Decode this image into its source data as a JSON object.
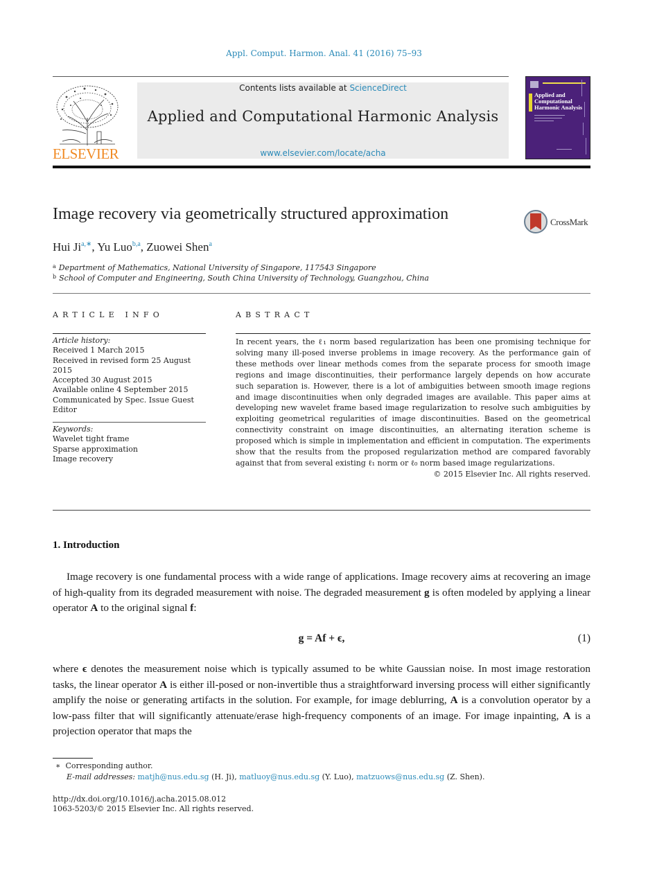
{
  "header": {
    "journal_ref": "Appl. Comput. Harmon. Anal. 41 (2016) 75–93",
    "publisher_logo_text": "ELSEVIER",
    "contents_prefix": "Contents lists available at ",
    "contents_link": "ScienceDirect",
    "journal_name": "Applied and Computational Harmonic Analysis",
    "journal_url": "www.elsevier.com/locate/acha",
    "cover": {
      "title_line1": "Applied and",
      "title_line2": "Computational",
      "title_line3": "Harmonic Analysis",
      "bg_color": "#4b2179",
      "accent_color": "#f0e04a"
    }
  },
  "article": {
    "title": "Image recovery via geometrically structured approximation",
    "crossmark_label": "CrossMark",
    "authors": [
      {
        "name": "Hui Ji",
        "marks": "a,∗"
      },
      {
        "name": "Yu Luo",
        "marks": "b,a"
      },
      {
        "name": "Zuowei Shen",
        "marks": "a"
      }
    ],
    "affiliations": [
      {
        "mark": "a",
        "text": "Department of Mathematics, National University of Singapore, 117543 Singapore"
      },
      {
        "mark": "b",
        "text": "School of Computer and Engineering, South China University of Technology, Guangzhou, China"
      }
    ]
  },
  "article_info": {
    "heading": "ARTICLE INFO",
    "history_label": "Article history:",
    "history": [
      "Received 1 March 2015",
      "Received in revised form 25 August 2015",
      "Accepted 30 August 2015",
      "Available online 4 September 2015",
      "Communicated by Spec. Issue Guest Editor"
    ],
    "keywords_label": "Keywords:",
    "keywords": [
      "Wavelet tight frame",
      "Sparse approximation",
      "Image recovery"
    ]
  },
  "abstract": {
    "heading": "ABSTRACT",
    "text": "In recent years, the ℓ₁ norm based regularization has been one promising technique for solving many ill-posed inverse problems in image recovery. As the performance gain of these methods over linear methods comes from the separate process for smooth image regions and image discontinuities, their performance largely depends on how accurate such separation is. However, there is a lot of ambiguities between smooth image regions and image discontinuities when only degraded images are available. This paper aims at developing new wavelet frame based image regularization to resolve such ambiguities by exploiting geometrical regularities of image discontinuities. Based on the geometrical connectivity constraint on image discontinuities, an alternating iteration scheme is proposed which is simple in implementation and efficient in computation. The experiments show that the results from the proposed regularization method are compared favorably against that from several existing ℓ₁ norm or ℓ₀ norm based image regularizations.",
    "copyright": "© 2015 Elsevier Inc. All rights reserved."
  },
  "body": {
    "section_title": "1. Introduction",
    "para1": {
      "t1": "Image recovery is one fundamental process with a wide range of applications. Image recovery aims at recovering an image of high-quality from its degraded measurement with noise. The degraded measurement ",
      "g": "g",
      "t2": " is often modeled by applying a linear operator ",
      "A": "A",
      "t3": " to the original signal ",
      "f": "f",
      "t4": ":"
    },
    "equation": {
      "text": "g = Af + ϵ,",
      "number": "(1)"
    },
    "para2": {
      "t1": "where ",
      "eps": "ϵ",
      "t2": " denotes the measurement noise which is typically assumed to be white Gaussian noise. In most image restoration tasks, the linear operator ",
      "A1": "A",
      "t3": " is either ill-posed or non-invertible thus a straightforward inversing process will either significantly amplify the noise or generating artifacts in the solution. For example, for image deblurring, ",
      "A2": "A",
      "t4": " is a convolution operator by a low-pass filter that will significantly attenuate/erase high-frequency components of an image. For image inpainting, ",
      "A3": "A",
      "t5": " is a projection operator that maps the"
    }
  },
  "footnotes": {
    "corresponding_mark": "∗",
    "corresponding_text": "Corresponding author.",
    "email_label": "E-mail addresses:",
    "emails": [
      {
        "address": "matjh@nus.edu.sg",
        "who": "(H. Ji),"
      },
      {
        "address": "matluoy@nus.edu.sg",
        "who": "(Y. Luo),"
      },
      {
        "address": "matzuows@nus.edu.sg",
        "who": "(Z. Shen)."
      }
    ],
    "doi": "http://dx.doi.org/10.1016/j.acha.2015.08.012",
    "issn": "1063-5203/© 2015 Elsevier Inc. All rights reserved."
  },
  "colors": {
    "link": "#2a8ab8",
    "elsevier_orange": "#f08a24",
    "header_box": "#ebebeb",
    "crossmark_red": "#c0392b"
  }
}
